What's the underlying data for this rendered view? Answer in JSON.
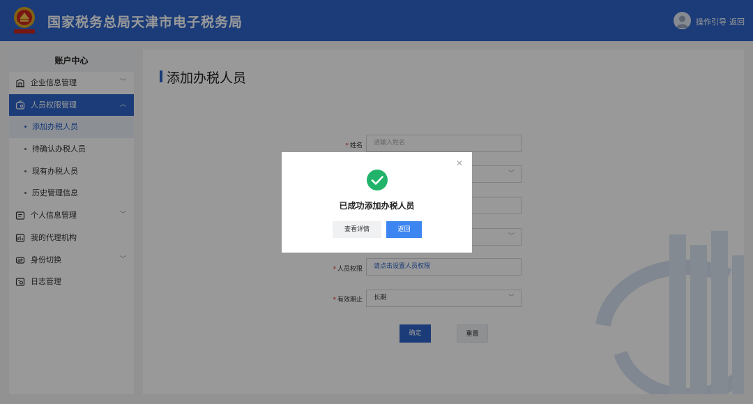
{
  "header": {
    "title": "国家税务总局天津市电子税务局",
    "guide_label": "操作引导",
    "back_label": "返回"
  },
  "sidebar": {
    "title": "账户中心",
    "items": [
      {
        "label": "企业信息管理",
        "icon": "building-icon"
      },
      {
        "label": "人员权限管理",
        "icon": "user-permission-icon"
      },
      {
        "label": "个人信息管理",
        "icon": "profile-card-icon"
      },
      {
        "label": "我的代理机构",
        "icon": "agency-icon"
      },
      {
        "label": "身份切换",
        "icon": "switch-identity-icon"
      },
      {
        "label": "日志管理",
        "icon": "log-icon"
      }
    ],
    "sub_items": [
      {
        "label": "添加办税人员"
      },
      {
        "label": "待确认办税人员"
      },
      {
        "label": "现有办税人员"
      },
      {
        "label": "历史管理信息"
      }
    ]
  },
  "main": {
    "page_title": "添加办税人员",
    "form": {
      "name_label": "姓名",
      "name_placeholder": "请输入姓名",
      "permission_label": "人员权限",
      "permission_value": "请点击设置人员权限",
      "validity_label": "有效期止",
      "validity_value": "长期"
    },
    "confirm_label": "确定",
    "reset_label": "重置"
  },
  "dialog": {
    "message": "已成功添加办税人员",
    "detail_label": "查看详情",
    "back_label": "返回"
  },
  "colors": {
    "brand": "#2d64c8",
    "success": "#21b36a",
    "dialog_primary": "#3d85f0"
  }
}
